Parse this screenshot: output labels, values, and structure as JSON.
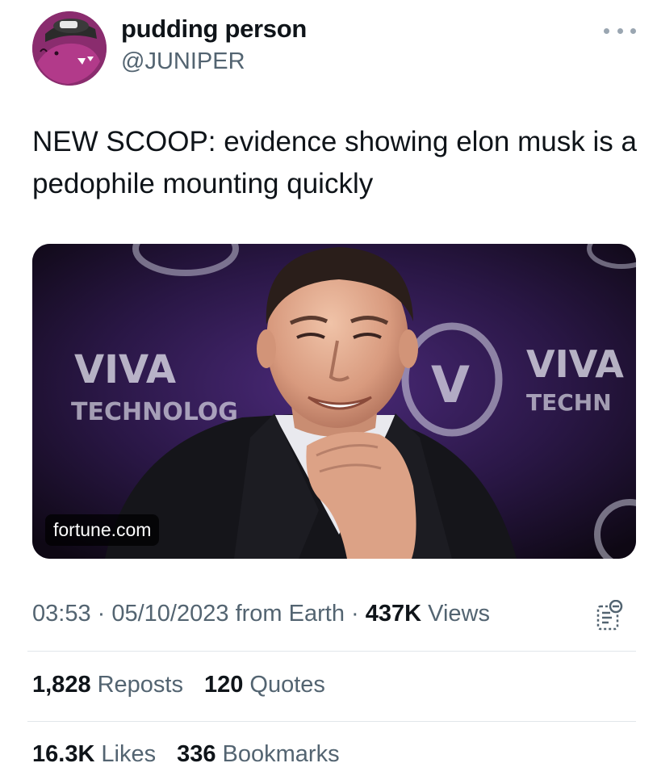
{
  "author": {
    "display_name": "pudding person",
    "handle": "@JUNIPER",
    "avatar_icon": "cartoon-dinosaur-avatar"
  },
  "post": {
    "text": "NEW SCOOP:  evidence showing elon musk is a pedophile mounting quickly"
  },
  "media": {
    "domain": "fortune.com",
    "backdrop_words": [
      "VIVA",
      "TECHNOLOG",
      "VIVA",
      "TECHN"
    ],
    "backdrop_letter": "V"
  },
  "meta": {
    "time": "03:53",
    "separator": " · ",
    "date": "05/10/2023",
    "source": "from Earth",
    "views_count": "437K",
    "views_label": "Views"
  },
  "stats": {
    "reposts_count": "1,828",
    "reposts_label": "Reposts",
    "quotes_count": "120",
    "quotes_label": "Quotes",
    "likes_count": "16.3K",
    "likes_label": "Likes",
    "bookmarks_count": "336",
    "bookmarks_label": "Bookmarks"
  },
  "colors": {
    "text_primary": "#0f1419",
    "text_secondary": "#536471",
    "divider": "#e1e6ea",
    "avatar_bg": "#8a2c6e"
  }
}
